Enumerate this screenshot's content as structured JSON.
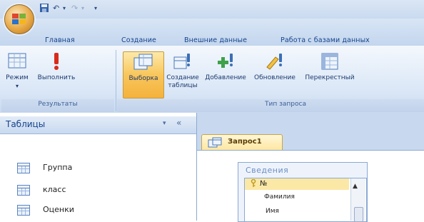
{
  "quick_access": {
    "undo_arrow": "↶",
    "redo_arrow": "↷",
    "separator": "▾"
  },
  "tabs": [
    "Главная",
    "Создание",
    "Внешние данные",
    "Работа с базами данных"
  ],
  "ribbon": {
    "results_group": {
      "label": "Результаты",
      "buttons": [
        {
          "label": "Режим"
        },
        {
          "label": "Выполнить"
        }
      ]
    },
    "query_type_group": {
      "label": "Тип запроса",
      "buttons": [
        {
          "label": "Выборка",
          "active": true
        },
        {
          "label": "Создание таблицы"
        },
        {
          "label": "Добавление"
        },
        {
          "label": "Обновление"
        },
        {
          "label": "Перекрестный"
        }
      ]
    }
  },
  "nav_pane": {
    "title": "Таблицы",
    "dropdown_glyph": "▾",
    "collapse_glyph": "«",
    "items": [
      "Группа",
      "класс",
      "Оценки"
    ]
  },
  "document": {
    "tab_label": "Запрос1",
    "table": {
      "title": "Сведения",
      "fields": [
        "№",
        "Фамилия",
        "Имя"
      ],
      "selected_field": "№"
    }
  },
  "colors": {
    "accent": "#f8c65b",
    "ribbon": "#d9e6f6",
    "text": "#15428b"
  }
}
